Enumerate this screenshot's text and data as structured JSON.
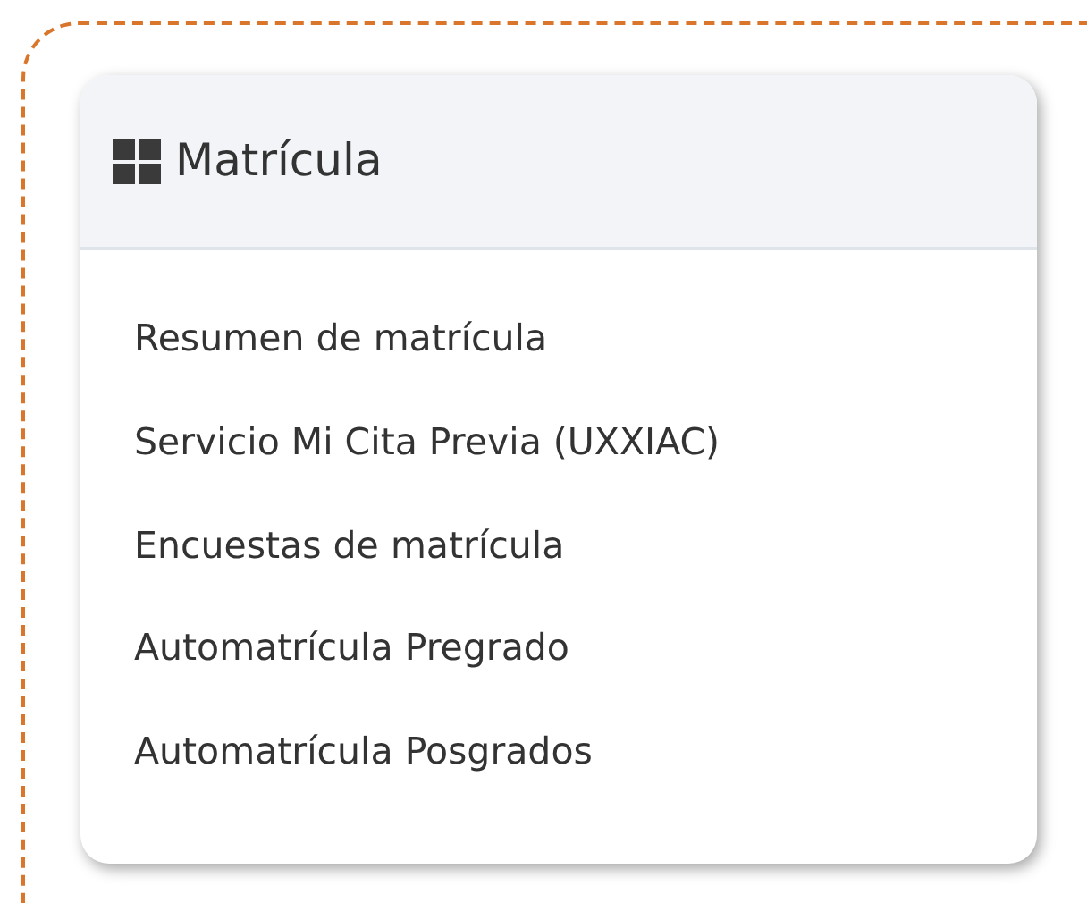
{
  "panel": {
    "title": "Matrícula",
    "items": [
      {
        "label": "Resumen de matrícula"
      },
      {
        "label": "Servicio Mi Cita Previa (UXXIAC)"
      },
      {
        "label": "Encuestas de matrícula"
      },
      {
        "label": "Automatrícula Pregrado"
      },
      {
        "label": "Automatrícula Posgrados"
      }
    ]
  }
}
